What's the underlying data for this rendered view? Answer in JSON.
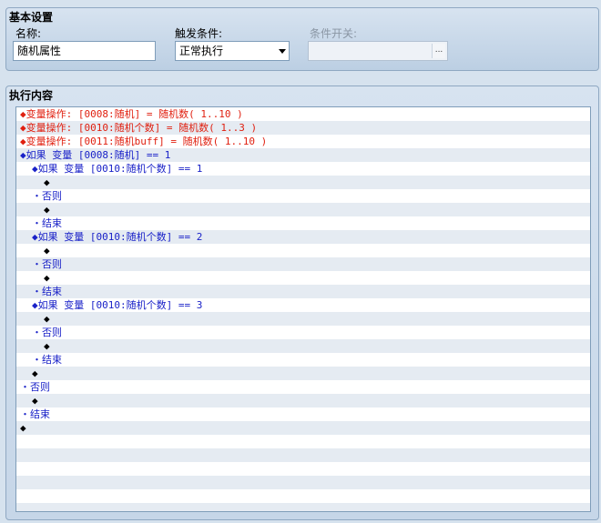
{
  "basic": {
    "title": "基本设置",
    "name_label": "名称:",
    "name_value": "随机属性",
    "trigger_label": "触发条件:",
    "trigger_value": "正常执行",
    "switch_label": "条件开关:",
    "switch_button": "..."
  },
  "exec": {
    "title": "执行内容",
    "lines": [
      {
        "indent": 0,
        "text": "◆变量操作: [0008:随机] = 随机数( 1..10 )",
        "color": "red"
      },
      {
        "indent": 0,
        "text": "◆变量操作: [0010:随机个数] = 随机数( 1..3 )",
        "color": "red"
      },
      {
        "indent": 0,
        "text": "◆变量操作: [0011:随机buff] = 随机数( 1..10 )",
        "color": "red"
      },
      {
        "indent": 0,
        "text": "◆如果 变量 [0008:随机] == 1",
        "color": "blue"
      },
      {
        "indent": 1,
        "text": "◆如果 变量 [0010:随机个数] == 1",
        "color": "blue"
      },
      {
        "indent": 2,
        "text": "◆",
        "color": "black"
      },
      {
        "indent": 1,
        "text": "・否则",
        "color": "blue"
      },
      {
        "indent": 2,
        "text": "◆",
        "color": "black"
      },
      {
        "indent": 1,
        "text": "・结束",
        "color": "blue"
      },
      {
        "indent": 1,
        "text": "◆如果 变量 [0010:随机个数] == 2",
        "color": "blue"
      },
      {
        "indent": 2,
        "text": "◆",
        "color": "black"
      },
      {
        "indent": 1,
        "text": "・否则",
        "color": "blue"
      },
      {
        "indent": 2,
        "text": "◆",
        "color": "black"
      },
      {
        "indent": 1,
        "text": "・结束",
        "color": "blue"
      },
      {
        "indent": 1,
        "text": "◆如果 变量 [0010:随机个数] == 3",
        "color": "blue"
      },
      {
        "indent": 2,
        "text": "◆",
        "color": "black"
      },
      {
        "indent": 1,
        "text": "・否则",
        "color": "blue"
      },
      {
        "indent": 2,
        "text": "◆",
        "color": "black"
      },
      {
        "indent": 1,
        "text": "・结束",
        "color": "blue"
      },
      {
        "indent": 1,
        "text": "◆",
        "color": "black"
      },
      {
        "indent": 0,
        "text": "・否则",
        "color": "blue"
      },
      {
        "indent": 1,
        "text": "◆",
        "color": "black"
      },
      {
        "indent": 0,
        "text": "・结束",
        "color": "blue"
      },
      {
        "indent": 0,
        "text": "◆",
        "color": "black"
      },
      {
        "indent": 0,
        "text": "",
        "color": "black"
      },
      {
        "indent": 0,
        "text": "",
        "color": "black"
      },
      {
        "indent": 0,
        "text": "",
        "color": "black"
      },
      {
        "indent": 0,
        "text": "",
        "color": "black"
      },
      {
        "indent": 0,
        "text": "",
        "color": "black"
      },
      {
        "indent": 0,
        "text": "",
        "color": "black"
      }
    ]
  }
}
